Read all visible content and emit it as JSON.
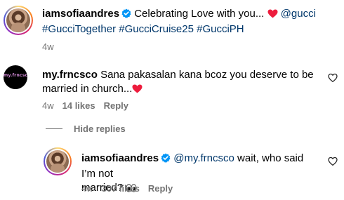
{
  "post_caption": {
    "username": "iamsofiaandres",
    "verified": true,
    "text": "Celebrating Love with you...",
    "mention": "@gucci",
    "hashtags": "#GucciTogether #GucciCruise25 #GucciPH",
    "time": "4w"
  },
  "comment": {
    "avatar_text": "my.frncsco",
    "username": "my.frncsco",
    "text_line1": "Sana pakasalan kana bcoz you deserve to be",
    "text_line2": "married in church...",
    "time": "4w",
    "likes": "14 likes",
    "reply_label": "Reply"
  },
  "hide_replies_label": "Hide replies",
  "reply": {
    "username": "iamsofiaandres",
    "verified": true,
    "mention": "@my.frncsco",
    "text_line1": "wait, who said I’m not",
    "text_line2": "married?",
    "time": "4w",
    "likes": "307 likes",
    "reply_label": "Reply"
  },
  "colors": {
    "verified_blue": "#0095f6",
    "link": "#00376b",
    "muted": "#737373",
    "heart_red": "#ed1c3d"
  },
  "icons": {
    "verified": "verified-badge-icon",
    "heart_emoji": "red-heart-emoji",
    "like_button": "heart-outline-icon",
    "eyes_emoji": "eyes-emoji"
  }
}
